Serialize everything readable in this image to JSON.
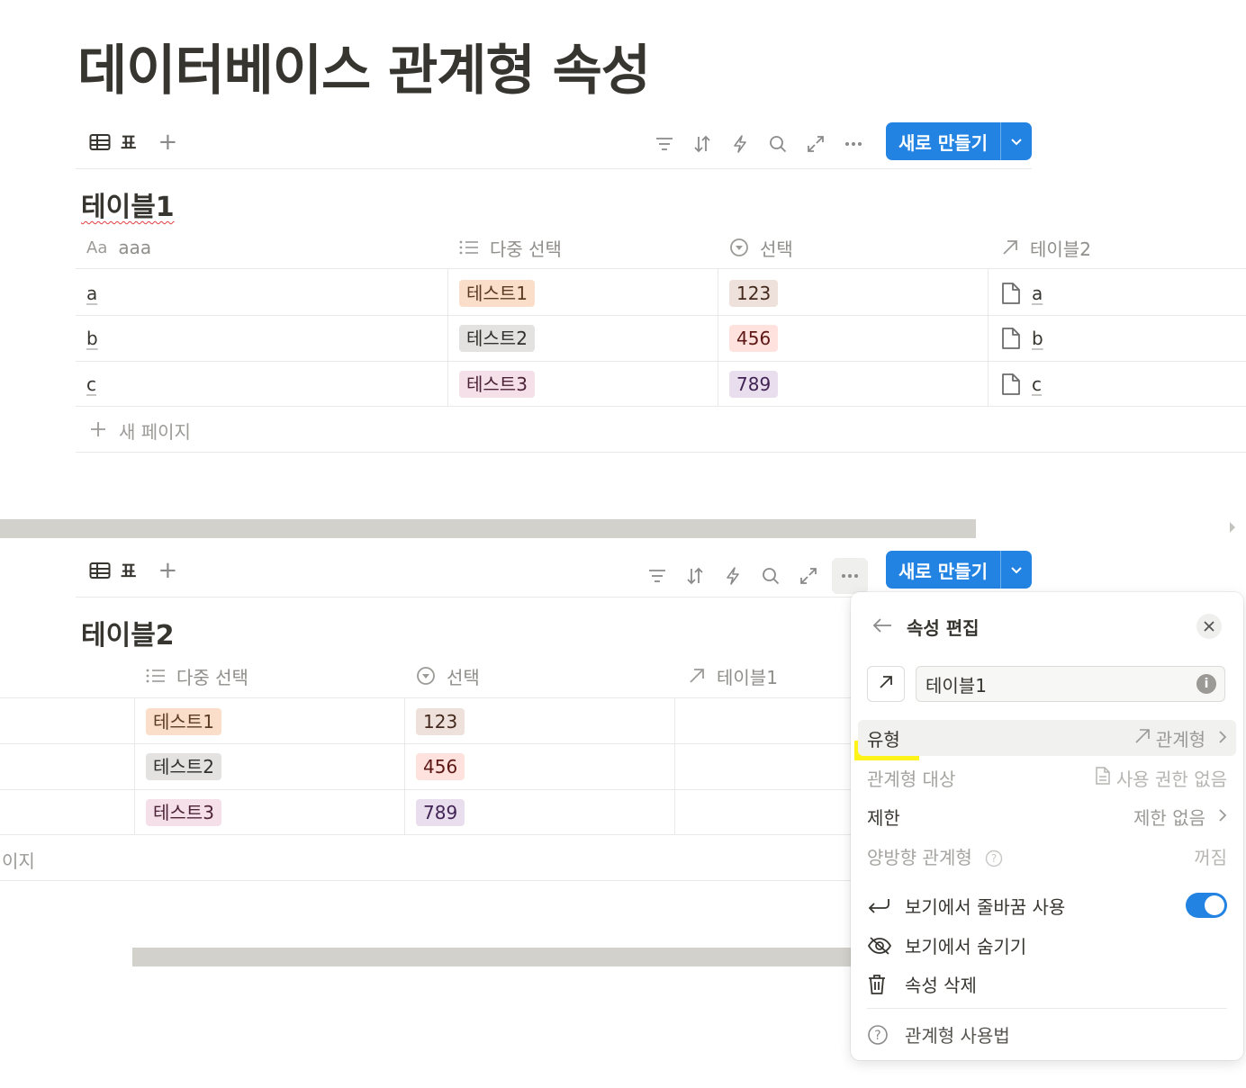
{
  "page": {
    "title": "데이터베이스 관계형 속성"
  },
  "toolbar": {
    "view_tab_label": "표",
    "add_view": "+",
    "new_button_label": "새로 만들기"
  },
  "table1": {
    "title": "테이블1",
    "columns": {
      "name_prefix": "Aa",
      "name": "aaa",
      "multi": "다중 선택",
      "select": "선택",
      "relation": "테이블2"
    },
    "rows": [
      {
        "name": "a",
        "multi": "테스트1",
        "select": "123",
        "relation": "a"
      },
      {
        "name": "b",
        "multi": "테스트2",
        "select": "456",
        "relation": "b"
      },
      {
        "name": "c",
        "multi": "테스트3",
        "select": "789",
        "relation": "c"
      }
    ],
    "new_page": "새 페이지"
  },
  "table2": {
    "title": "테이블2",
    "columns": {
      "multi": "다중 선택",
      "select": "선택",
      "relation": "테이블1"
    },
    "rows": [
      {
        "multi": "테스트1",
        "select": "123"
      },
      {
        "multi": "테스트2",
        "select": "456"
      },
      {
        "multi": "테스트3",
        "select": "789"
      }
    ],
    "new_page_partial": "이지"
  },
  "tag_colors": {
    "테스트1": {
      "bg": "#fadec9",
      "fg": "#5c3b23"
    },
    "테스트2": {
      "bg": "#e3e2e0",
      "fg": "#32302c"
    },
    "테스트3": {
      "bg": "#f5e0e9",
      "fg": "#4c2337"
    },
    "123": {
      "bg": "#eee0da",
      "fg": "#442a1e"
    },
    "456": {
      "bg": "#ffe2dd",
      "fg": "#5d1715"
    },
    "789": {
      "bg": "#e8deee",
      "fg": "#412454"
    }
  },
  "panel": {
    "title": "속성 편집",
    "name_value": "테이블1",
    "rows": {
      "type_label": "유형",
      "type_value": "관계형",
      "target_label": "관계형 대상",
      "target_value": "사용 권한 없음",
      "limit_label": "제한",
      "limit_value": "제한 없음",
      "two_way_label": "양방향 관계형",
      "two_way_value": "꺼짐"
    },
    "actions": {
      "wrap": "보기에서 줄바꿈 사용",
      "hide": "보기에서 숨기기",
      "delete": "속성 삭제",
      "help": "관계형 사용법"
    },
    "wrap_enabled": true
  },
  "colors": {
    "accent": "#2383e2",
    "highlight": "#fff200"
  }
}
